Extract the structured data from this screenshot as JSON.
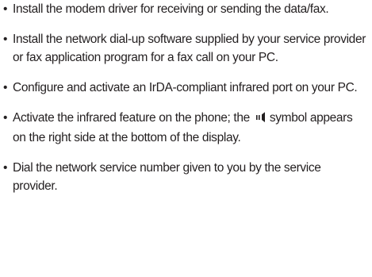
{
  "bullet_symbol": "•",
  "items": [
    {
      "text": "Install the modem driver for receiving or sending the data/fax."
    },
    {
      "text": "Install the network dial-up software supplied by your service provider or fax application program for a fax call on your PC."
    },
    {
      "text": "Configure and activate an IrDA-compliant infrared port on your PC."
    },
    {
      "text_before_icon": "Activate the infrared feature on the phone; the",
      "icon": "infrared-icon",
      "text_after_icon": "symbol appears on the right side at the bottom of the display."
    },
    {
      "text": "Dial the network service number given to you by the service provider."
    }
  ]
}
